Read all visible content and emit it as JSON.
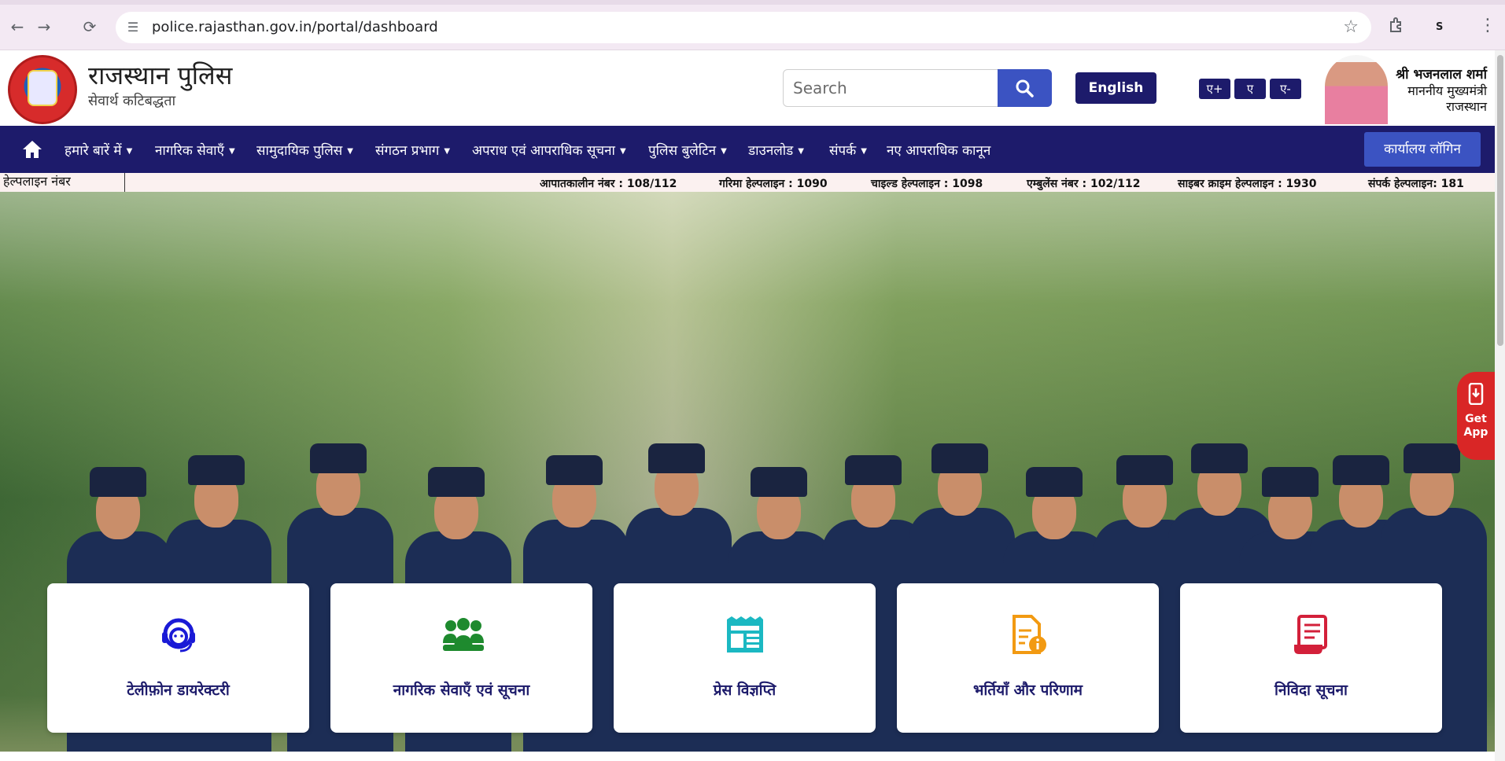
{
  "browser": {
    "url": "police.rajasthan.gov.in/portal/dashboard"
  },
  "header": {
    "title": "राजस्थान पुलिस",
    "tagline": "सेवार्थ कटिबद्धता",
    "search_placeholder": "Search",
    "language_button": "English",
    "font_controls": [
      "ए+",
      "ए",
      "ए-"
    ],
    "cm": {
      "name": "श्री भजनलाल शर्मा",
      "designation": "माननीय मुख्यमंत्री",
      "state": "राजस्थान"
    }
  },
  "nav": {
    "items": [
      {
        "label": "हमारे बारें में",
        "dropdown": true
      },
      {
        "label": "नागरिक सेवाएँ",
        "dropdown": true
      },
      {
        "label": "सामुदायिक पुलिस",
        "dropdown": true
      },
      {
        "label": "संगठन प्रभाग",
        "dropdown": true
      },
      {
        "label": "अपराध एवं आपराधिक सूचना",
        "dropdown": true
      },
      {
        "label": "पुलिस बुलेटिन",
        "dropdown": true
      },
      {
        "label": "डाउनलोड",
        "dropdown": true
      },
      {
        "label": "संपर्क",
        "dropdown": true
      },
      {
        "label": "नए आपराधिक कानून",
        "dropdown": false
      }
    ],
    "caret": "▼",
    "office_login": "कार्यालय लॉगिन"
  },
  "helpline": {
    "label": "हेल्पलाइन नंबर",
    "items": [
      "आपातकालीन नंबर : 108/112",
      "गरिमा हेल्पलाइन : 1090",
      "चाइल्ड हेल्पलाइन : 1098",
      "एम्बुलेंस नंबर : 102/112",
      "साइबर क्राइम हेल्पलाइन : 1930",
      "संपर्क हेल्पलाइन: 181"
    ]
  },
  "get_app": {
    "line1": "Get",
    "line2": "App"
  },
  "cards": [
    {
      "label": "टेलीफ़ोन डायरेक्टरी",
      "icon": "headset-icon",
      "color": "#1a1ad6"
    },
    {
      "label": "नागरिक सेवाएँ एवं सूचना",
      "icon": "people-group-icon",
      "color": "#1e8a2e"
    },
    {
      "label": "प्रेस विज्ञप्ति",
      "icon": "newspaper-icon",
      "color": "#1bb8c2"
    },
    {
      "label": "भर्तियाँ और परिणाम",
      "icon": "document-info-icon",
      "color": "#f29a12"
    },
    {
      "label": "निविदा सूचना",
      "icon": "tender-document-icon",
      "color": "#d3203a"
    }
  ],
  "colors": {
    "nav_bg": "#1d1b6b",
    "accent_blue": "#3b53c2",
    "get_app_red": "#d92626"
  }
}
